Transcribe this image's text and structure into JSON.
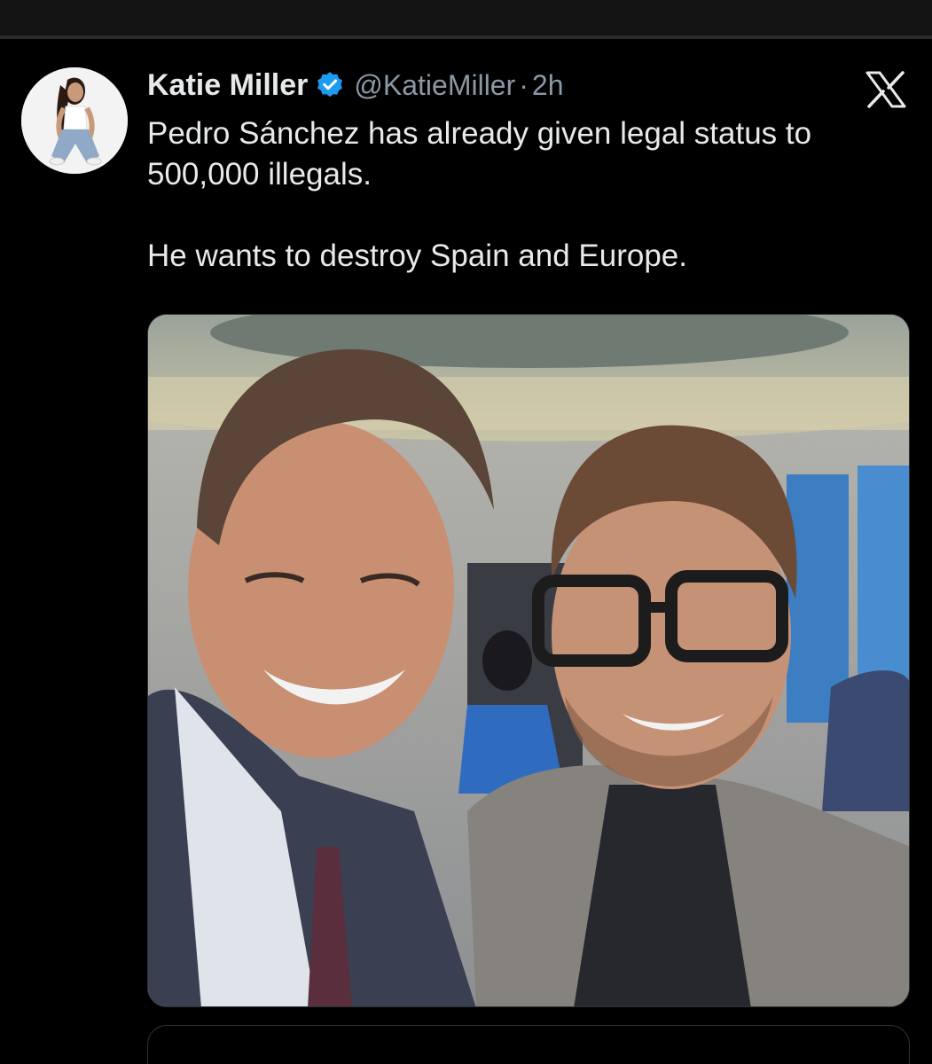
{
  "tweet": {
    "author": {
      "display_name": "Katie Miller",
      "handle": "@KatieMiller",
      "verified": true,
      "verified_color": "#1d9bf0"
    },
    "separator": "·",
    "time": "2h",
    "platform_icon": "x-logo-icon",
    "text_lines": [
      "Pedro Sánchez has already given legal status to 500,000 illegals.",
      "He wants to destroy Spain and Europe."
    ],
    "media": {
      "kind": "photo",
      "icon": "photo-icon"
    }
  },
  "colors": {
    "background": "#000000",
    "text": "#e7e9ea",
    "secondary_text": "#8b98a5",
    "border": "#2f3336"
  }
}
